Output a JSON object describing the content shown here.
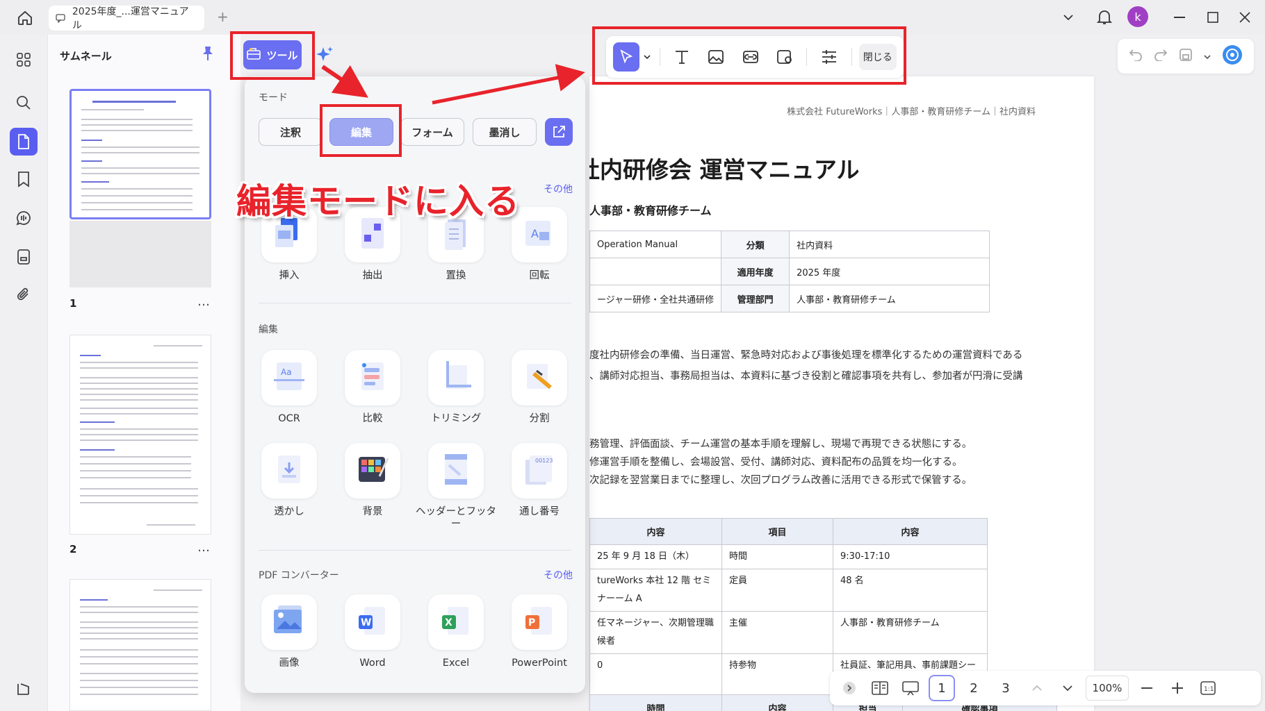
{
  "tab": {
    "title": "2025年度_...運営マニュアル"
  },
  "avatar": {
    "letter": "k",
    "color": "#a03fc4"
  },
  "sidebar": {
    "title": "サムネール",
    "pages": [
      "1",
      "2"
    ],
    "more": "…"
  },
  "tools_button": {
    "label": "ツール"
  },
  "toolbar": {
    "close_label": "閉じる"
  },
  "popup": {
    "mode_label": "モード",
    "modes": [
      "注釈",
      "編集",
      "フォーム",
      "墨消し"
    ],
    "selected_mode": "編集",
    "more_label": "その他",
    "page_tools": [
      "挿入",
      "抽出",
      "置換",
      "回転"
    ],
    "edit_label": "編集",
    "edit_tools": [
      "OCR",
      "比較",
      "トリミング",
      "分割",
      "透かし",
      "背景",
      "ヘッダーとフッター",
      "通し番号"
    ],
    "converter_label": "PDF コンバーター",
    "converter_more": "その他",
    "converters": [
      "画像",
      "Word",
      "Excel",
      "PowerPoint"
    ]
  },
  "annotation": {
    "text": "編集モードに入る",
    "color": "#e8232b"
  },
  "document": {
    "header": "株式会社 FutureWorks｜人事部・教育研修チーム｜社内資料",
    "title": "社内研修会 運営マニュアル",
    "dept": "人事部・教育研修チーム",
    "info": [
      [
        "Operation Manual",
        "分類",
        "社内資料"
      ],
      [
        "",
        "適用年度",
        "2025 年度"
      ],
      [
        "ージャー研修・全社共通研修",
        "管理部門",
        "人事部・教育研修チーム"
      ]
    ],
    "para1": "度社内研修会の準備、当日運営、緊急時対応および事後処理を標準化するための運営資料である",
    "para2": "、講師対応担当、事務局担当は、本資料に基づき役割と確認事項を共有し、参加者が円滑に受講",
    "goals": [
      "務管理、評価面談、チーム運営の基本手順を理解し、現場で再現できる状態にする。",
      "修運営手順を整備し、会場設営、受付、講師対応、資料配布の品質を均一化する。",
      "次記録を翌営業日までに整理し、次回プログラム改善に活用できる形式で保管する。"
    ],
    "sched_headers": [
      "内容",
      "項目",
      "内容"
    ],
    "sched_rows": [
      [
        "25 年 9 月 18 日（木）",
        "時間",
        "9:30-17:10"
      ],
      [
        "tureWorks 本社 12 階 セミナーーム A",
        "定員",
        "48 名"
      ],
      [
        "任マネージャー、次期管理職候者",
        "主催",
        "人事部・教育研修チーム"
      ],
      [
        "0",
        "持参物",
        "社員証、筆記用具、事前課題シート"
      ]
    ],
    "bottom_headers": [
      "時間",
      "内容",
      "担当",
      "確認事項"
    ]
  },
  "bottombar": {
    "pages": [
      "1",
      "2",
      "3"
    ],
    "current": "1",
    "zoom": "100%"
  }
}
